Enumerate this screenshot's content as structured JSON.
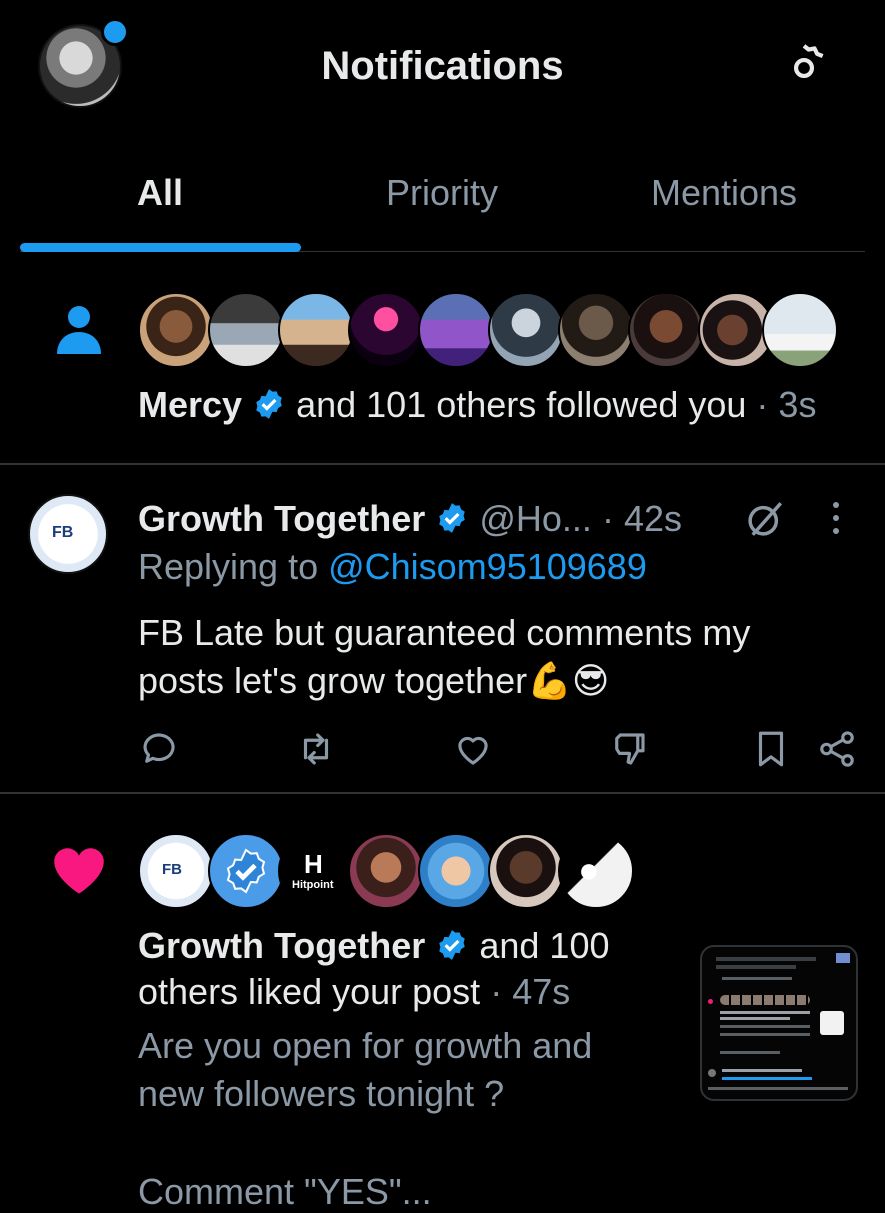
{
  "header": {
    "title": "Notifications"
  },
  "tabs": [
    {
      "label": "All"
    },
    {
      "label": "Priority"
    },
    {
      "label": "Mentions"
    }
  ],
  "follow_notification": {
    "name": "Mercy",
    "text": "and 101 others followed you",
    "separator": " · ",
    "time": "3s"
  },
  "reply_notification": {
    "avatar_text": "FB",
    "name": "Growth Together",
    "handle": "@Ho...",
    "separator": " · ",
    "time": "42s",
    "replying_prefix": "Replying to ",
    "replying_handle": "@Chisom95109689",
    "body_line1": "FB Late but guaranteed comments my",
    "body_line2": "posts let's grow together",
    "emoji": "💪😎"
  },
  "like_notification": {
    "avatar_fb_text": "FB",
    "avatar_hitpoint_text": "Hitpoint",
    "name": "Growth Together",
    "text_after_name": "and 100",
    "text_line2": "others liked your post",
    "separator": " · ",
    "time": "47s",
    "post_line1": "Are you open for growth and",
    "post_line2": "new followers tonight ?",
    "post_line3": "Comment \"YES\"..."
  },
  "colors": {
    "accent": "#1d9bf0",
    "like": "#f91880",
    "muted": "#8b98a5",
    "divider": "#2f3336"
  }
}
